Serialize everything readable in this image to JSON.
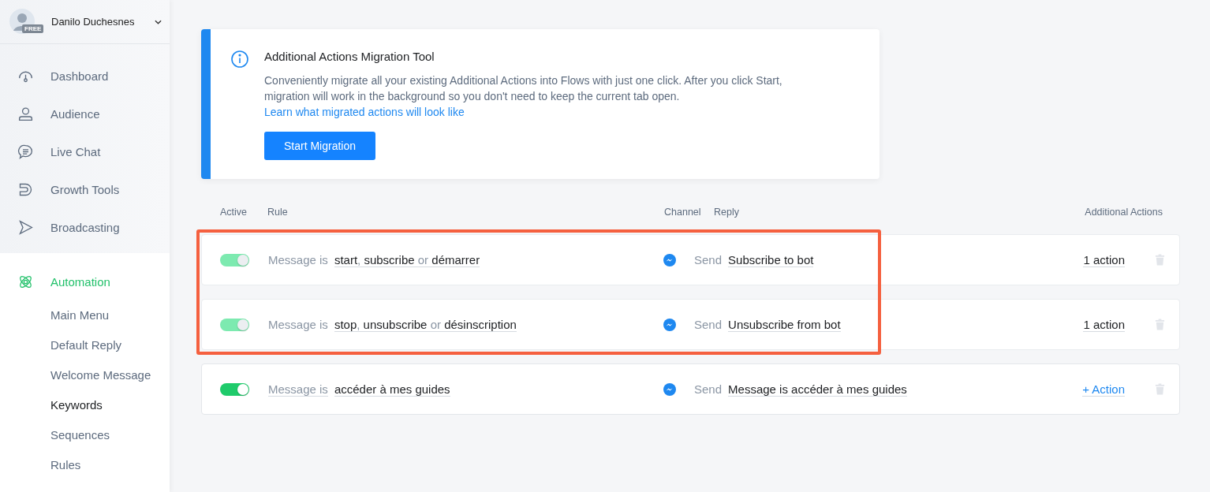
{
  "account": {
    "name": "Danilo Duchesnes",
    "plan": "FREE"
  },
  "nav": [
    {
      "label": "Dashboard",
      "kind": "gauge",
      "selected": false
    },
    {
      "label": "Audience",
      "kind": "person",
      "selected": false
    },
    {
      "label": "Live Chat",
      "kind": "chat",
      "selected": false
    },
    {
      "label": "Growth Tools",
      "kind": "magnet",
      "selected": false
    },
    {
      "label": "Broadcasting",
      "kind": "send",
      "selected": false
    }
  ],
  "automation": {
    "label": "Automation",
    "selected": true,
    "children": [
      {
        "label": "Main Menu",
        "selected": false
      },
      {
        "label": "Default Reply",
        "selected": false
      },
      {
        "label": "Welcome Message",
        "selected": false
      },
      {
        "label": "Keywords",
        "selected": true
      },
      {
        "label": "Sequences",
        "selected": false
      },
      {
        "label": "Rules",
        "selected": false
      }
    ]
  },
  "banner": {
    "title": "Additional Actions Migration Tool",
    "text": "Conveniently migrate all your existing Additional Actions into Flows with just one click. After you click Start, migration will work in the background so you don't need to keep the current tab open.",
    "link": "Learn what migrated actions will look like",
    "button": "Start Migration"
  },
  "table": {
    "columns": [
      "Active",
      "Rule",
      "Channel",
      "Reply",
      "Additional Actions"
    ],
    "annotation": {
      "kind": "frame",
      "color": "#f5603f"
    },
    "rows": [
      {
        "on": true,
        "disabled": true,
        "highlighted": true,
        "prefix": "Message is",
        "prefix_editable": false,
        "rule_parts": [
          {
            "kind": "keyword",
            "text": "start"
          },
          {
            "kind": "sep",
            "text": ","
          },
          {
            "kind": "keyword",
            "text": "subscribe"
          },
          {
            "kind": "sep",
            "text": "or"
          },
          {
            "kind": "keyword",
            "text": "démarrer"
          }
        ],
        "send": "Send",
        "reply": "Subscribe to bot",
        "action": {
          "kind": "count",
          "text": "1 action"
        }
      },
      {
        "on": true,
        "disabled": true,
        "highlighted": true,
        "prefix": "Message is",
        "prefix_editable": false,
        "rule_parts": [
          {
            "kind": "keyword",
            "text": "stop"
          },
          {
            "kind": "sep",
            "text": ","
          },
          {
            "kind": "keyword",
            "text": "unsubscribe"
          },
          {
            "kind": "sep",
            "text": "or"
          },
          {
            "kind": "keyword",
            "text": "désinscription"
          }
        ],
        "send": "Send",
        "reply": "Unsubscribe from bot",
        "action": {
          "kind": "count",
          "text": "1 action"
        }
      },
      {
        "on": true,
        "disabled": false,
        "highlighted": false,
        "prefix": "Message is",
        "prefix_editable": true,
        "rule_parts": [
          {
            "kind": "keyword",
            "text": "accéder à mes guides"
          }
        ],
        "send": "Send",
        "reply": "Message is accéder à mes guides",
        "action": {
          "kind": "add",
          "text": "+ Action"
        }
      }
    ]
  }
}
